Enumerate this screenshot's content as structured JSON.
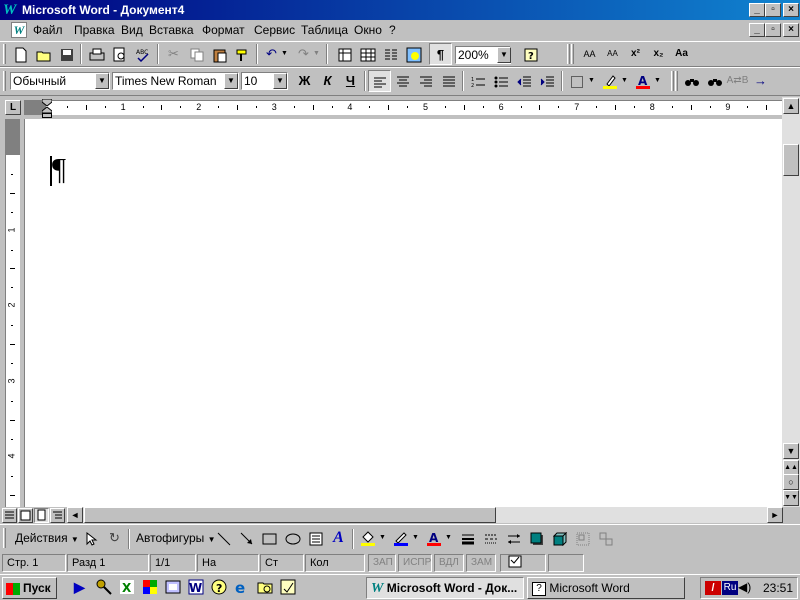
{
  "window": {
    "title": "Microsoft Word - Документ4",
    "minimize": "_",
    "restore": "▫",
    "close": "×"
  },
  "menu": [
    "Файл",
    "Правка",
    "Вид",
    "Вставка",
    "Формат",
    "Сервис",
    "Таблица",
    "Окно",
    "?"
  ],
  "menu_mnemonics": [
    "Ф",
    "П",
    "В",
    "с",
    "о",
    "р",
    "Т",
    "О",
    "?"
  ],
  "standard_toolbar": {
    "zoom_value": "200%"
  },
  "format_toolbar": {
    "style_value": "Обычный",
    "font_value": "Times New Roman",
    "size_value": "10",
    "bold": "Ж",
    "italic": "К",
    "underline": "Ч"
  },
  "ruler": {
    "numbers": [
      "1",
      "2",
      "3",
      "4",
      "5",
      "6",
      "7",
      "8",
      "9"
    ],
    "vnumbers": [
      "1",
      "2",
      "3",
      "4"
    ]
  },
  "drawing_toolbar": {
    "actions_label": "Действия",
    "autoshapes_label": "Автофигуры"
  },
  "statusbar": {
    "page": "Стр. 1",
    "section": "Разд 1",
    "pages": "1/1",
    "at": "На",
    "line": "Ст",
    "col": "Кол",
    "rec": "ЗАП",
    "trk": "ИСПР",
    "ext": "ВДЛ",
    "ovr": "ЗАМ"
  },
  "taskbar": {
    "start_label": "Пуск",
    "task1_label": "Microsoft Word - Док...",
    "task2_label": "Microsoft Word",
    "lang": "Ru",
    "clock": "23:51"
  },
  "colors": {
    "title_start": "#000080",
    "title_end": "#1084d0",
    "face": "#c0c0c0",
    "highlight": "#ffff00",
    "font_color": "#ff0000",
    "line_color": "#0000ff"
  }
}
